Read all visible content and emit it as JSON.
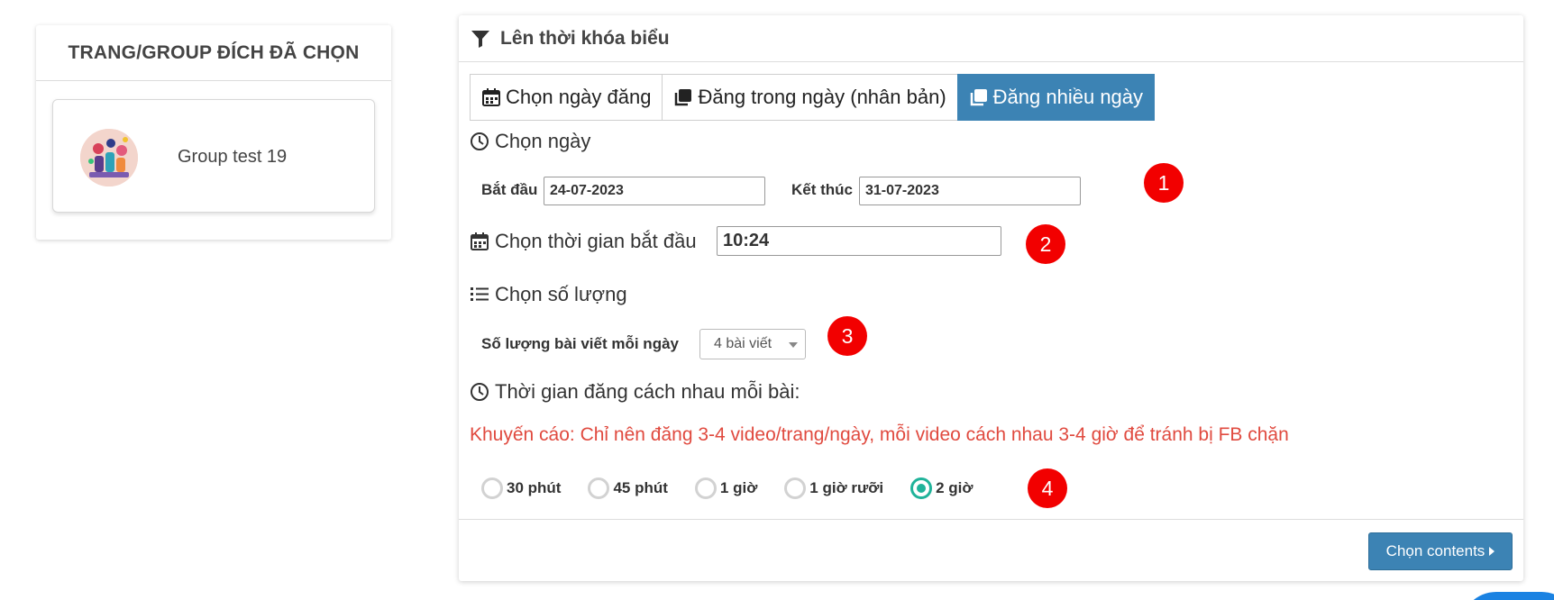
{
  "left_card": {
    "title": "TRANG/GROUP ĐÍCH ĐÃ CHỌN",
    "group_name": "Group test 19"
  },
  "panel": {
    "title": "Lên thời khóa biểu",
    "tabs": [
      {
        "label": "Chọn ngày đăng",
        "icon": "calendar-icon",
        "active": false
      },
      {
        "label": "Đăng trong ngày (nhân bản)",
        "icon": "copy-icon",
        "active": false
      },
      {
        "label": "Đăng nhiều ngày",
        "icon": "copy-icon",
        "active": true
      }
    ],
    "date_section": {
      "title": "Chọn ngày",
      "start_label": "Bắt đầu",
      "start_value": "24-07-2023",
      "end_label": "Kết thúc",
      "end_value": "31-07-2023"
    },
    "time_section": {
      "title": "Chọn thời gian bắt đầu",
      "value": "10:24"
    },
    "quantity_section": {
      "title": "Chọn số lượng",
      "label": "Số lượng bài viết mỗi ngày",
      "selected": "4 bài viết"
    },
    "interval_section": {
      "title": "Thời gian đăng cách nhau mỗi bài:",
      "warning": "Khuyến cáo: Chỉ nên đăng 3-4 video/trang/ngày, mỗi video cách nhau 3-4 giờ để tránh bị FB chặn",
      "options": [
        "30 phút",
        "45 phút",
        "1 giờ",
        "1 giờ rưỡi",
        "2 giờ"
      ],
      "selected": "2 giờ"
    },
    "badges": [
      "1",
      "2",
      "3",
      "4"
    ],
    "next_button": "Chọn contents"
  },
  "colors": {
    "accent": "#3c83b4",
    "badge": "#f20000",
    "warning": "#e04a3f",
    "radio_checked": "#20b39a"
  }
}
